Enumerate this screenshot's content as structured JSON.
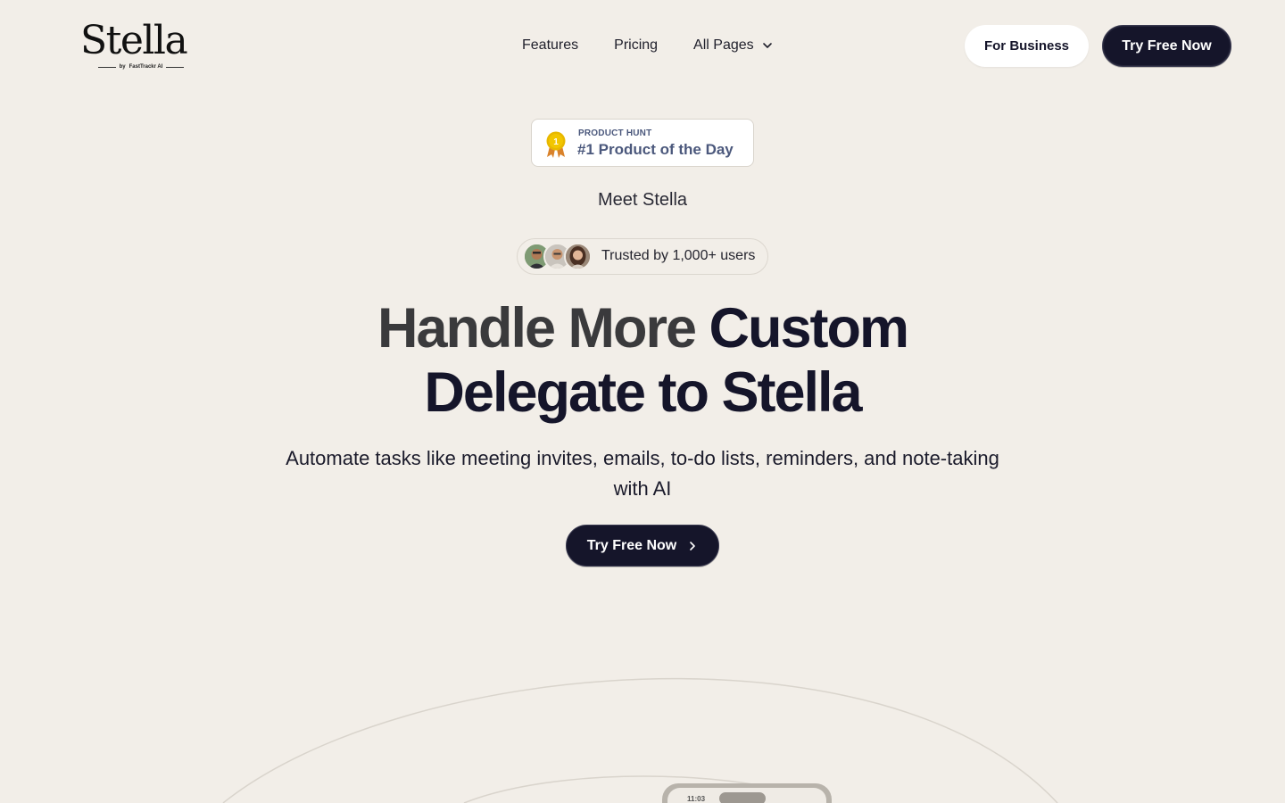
{
  "header": {
    "logo": {
      "name": "Stella",
      "sub_by": "by",
      "sub_brand": "FastTrackr AI"
    },
    "nav": {
      "features": "Features",
      "pricing": "Pricing",
      "all_pages": "All Pages"
    },
    "buttons": {
      "for_business": "For Business",
      "try_free": "Try Free Now"
    }
  },
  "badge": {
    "rank": "1",
    "source": "PRODUCT HUNT",
    "title": "#1 Product of the Day"
  },
  "intro": "Meet Stella",
  "trusted": {
    "text": "Trusted by 1,000+ users",
    "avatar_count": 3
  },
  "hero": {
    "line1_a": "Handle More",
    "line1_b": "Custom",
    "line2": "Delegate to Stella",
    "subtext": "Automate tasks like meeting invites, emails, to-do lists, reminders, and note-taking with AI",
    "cta": "Try Free Now"
  },
  "phone": {
    "time": "11:03"
  },
  "colors": {
    "background": "#f2eee8",
    "primary_dark": "#15152a",
    "badge_text": "#4b587c",
    "medal": "#e8b800"
  }
}
